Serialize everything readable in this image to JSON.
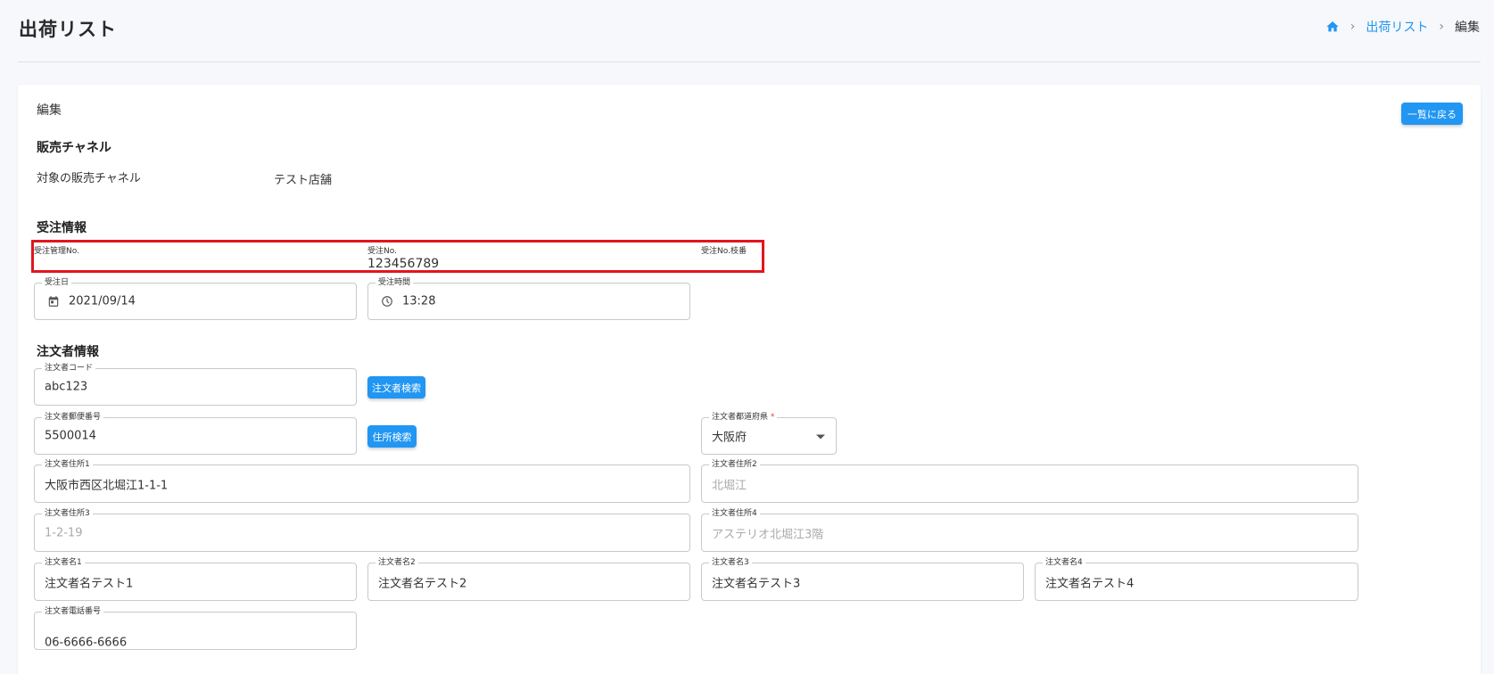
{
  "header": {
    "title": "出荷リスト",
    "breadcrumb": {
      "link": "出荷リスト",
      "current": "編集"
    }
  },
  "card": {
    "title": "編集",
    "back_label": "一覧に戻る"
  },
  "channel": {
    "section_title": "販売チャネル",
    "label": "対象の販売チャネル",
    "value": "テスト店舗"
  },
  "order": {
    "section_title": "受注情報",
    "mgmt_no_label": "受注管理No.",
    "mgmt_no_value": "",
    "order_no_label": "受注No.",
    "order_no_value": "123456789",
    "order_no_branch_label": "受注No.枝番",
    "order_no_branch_value": "",
    "order_date_label": "受注日",
    "order_date_value": "2021/09/14",
    "order_time_label": "受注時間",
    "order_time_value": "13:28"
  },
  "orderer": {
    "section_title": "注文者情報",
    "code_label": "注文者コード",
    "code_value": "abc123",
    "search_orderer_label": "注文者検索",
    "zip_label": "注文者郵便番号",
    "zip_value": "5500014",
    "search_address_label": "住所検索",
    "pref_label": "注文者都道府県",
    "pref_required": "*",
    "pref_value": "大阪府",
    "addr1_label": "注文者住所1",
    "addr1_value": "大阪市西区北堀江1-1-1",
    "addr2_label": "注文者住所2",
    "addr2_placeholder": "北堀江",
    "addr3_label": "注文者住所3",
    "addr3_placeholder": "1-2-19",
    "addr4_label": "注文者住所4",
    "addr4_placeholder": "アステリオ北堀江3階",
    "name1_label": "注文者名1",
    "name1_value": "注文者名テスト1",
    "name2_label": "注文者名2",
    "name2_value": "注文者名テスト2",
    "name3_label": "注文者名3",
    "name3_value": "注文者名テスト3",
    "name4_label": "注文者名4",
    "name4_value": "注文者名テスト4",
    "phone_label": "注文者電話番号",
    "phone_value": "06-6666-6666"
  },
  "icons": {
    "home": "home-icon",
    "calendar": "calendar-icon",
    "clock": "clock-icon",
    "dropdown": "chevron-down-icon"
  },
  "colors": {
    "primary": "#2196f3",
    "highlight": "#e3141e"
  }
}
